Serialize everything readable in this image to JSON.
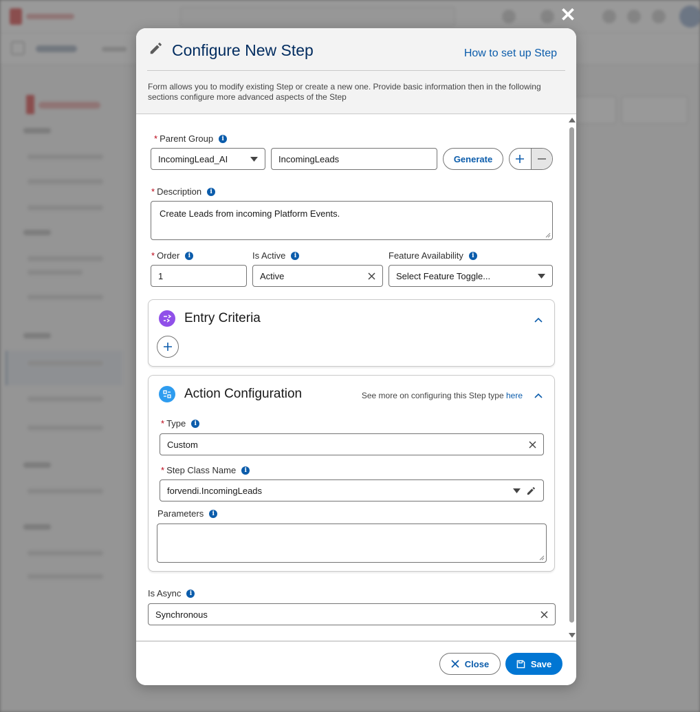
{
  "modal": {
    "title": "Configure New Step",
    "help_link": "How to set up Step",
    "description": "Form allows you to modify existing Step or create a new one. Provide basic information then in the following sections configure more advanced aspects of the Step"
  },
  "form": {
    "parent_group": {
      "label": "Parent Group",
      "selected": "IncomingLead_AI",
      "name_value": "IncomingLeads",
      "generate_label": "Generate"
    },
    "description": {
      "label": "Description",
      "value": "Create Leads from incoming Platform Events."
    },
    "order": {
      "label": "Order",
      "value": "1"
    },
    "is_active": {
      "label": "Is Active",
      "value": "Active"
    },
    "feature_availability": {
      "label": "Feature Availability",
      "placeholder": "Select Feature Toggle..."
    },
    "entry_criteria": {
      "title": "Entry Criteria"
    },
    "action_configuration": {
      "title": "Action Configuration",
      "note_text": "See more on configuring this Step type ",
      "note_link": "here",
      "type": {
        "label": "Type",
        "value": "Custom"
      },
      "step_class_name": {
        "label": "Step Class Name",
        "value": "forvendi.IncomingLeads"
      },
      "parameters": {
        "label": "Parameters",
        "value": ""
      }
    },
    "is_async": {
      "label": "Is Async",
      "value": "Synchronous"
    }
  },
  "footer": {
    "close_label": "Close",
    "save_label": "Save"
  },
  "icons": {
    "required_marker": "*",
    "info_glyph": "i",
    "close_overlay": "✕"
  },
  "colors": {
    "brand_blue": "#0176d3",
    "link_blue": "#0b5cab",
    "title_navy": "#032d60",
    "required_red": "#ba0517",
    "entry_icon_purple": "#9050e9",
    "action_icon_blue": "#2e9cef"
  }
}
